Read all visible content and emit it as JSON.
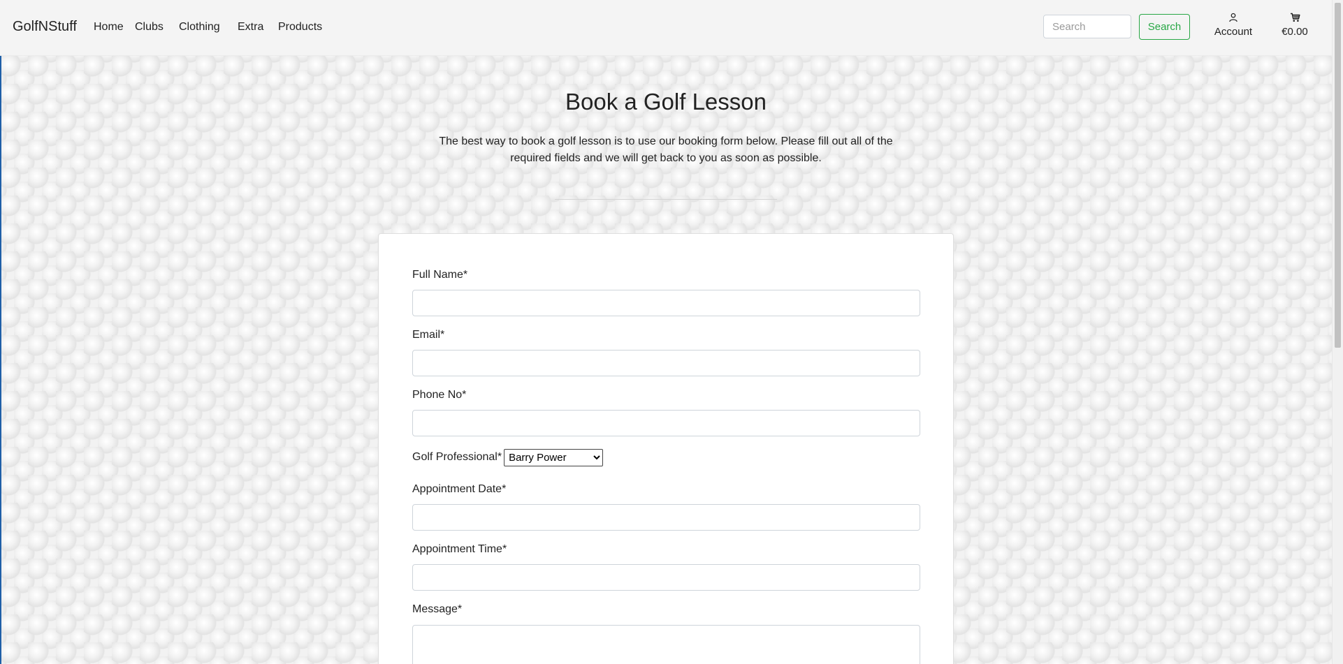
{
  "navbar": {
    "brand": "GolfNStuff",
    "links": [
      "Home",
      "Clubs",
      "Clothing",
      "Extra",
      "Products"
    ],
    "search_placeholder": "Search",
    "search_button": "Search",
    "account_label": "Account",
    "cart_total": "€0.00",
    "icons": {
      "account": "person-icon",
      "cart": "cart-icon"
    }
  },
  "main": {
    "title": "Book a Golf Lesson",
    "intro": "The best way to book a golf lesson is to use our booking form below. Please fill out all of the required fields and we will get back to you as soon as possible."
  },
  "form": {
    "full_name_label": "Full Name*",
    "email_label": "Email*",
    "phone_label": "Phone No*",
    "professional_label": "Golf Professional*",
    "professional_selected": "Barry Power",
    "date_label": "Appointment Date*",
    "time_label": "Appointment Time*",
    "message_label": "Message*"
  },
  "colors": {
    "accent_green": "#28a745",
    "navbar_bg": "#f4f4f4"
  }
}
